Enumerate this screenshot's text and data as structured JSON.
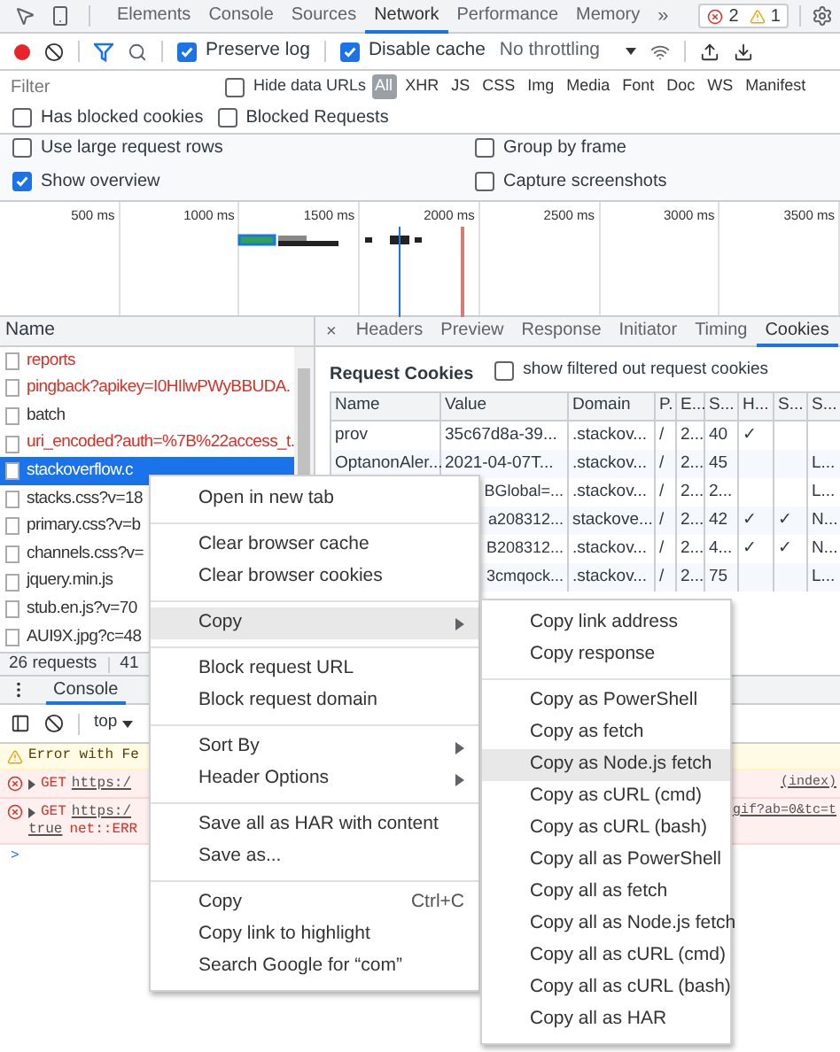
{
  "panel_tabs": [
    {
      "label": "Elements",
      "selected": false
    },
    {
      "label": "Console",
      "selected": false
    },
    {
      "label": "Sources",
      "selected": false
    },
    {
      "label": "Network",
      "selected": true
    },
    {
      "label": "Performance",
      "selected": false
    },
    {
      "label": "Memory",
      "selected": false
    }
  ],
  "more_tabs": "»",
  "issues": {
    "errors": "2",
    "warnings": "1"
  },
  "network_toolbar": {
    "recording": true,
    "preserve_log": {
      "label": "Preserve log",
      "checked": true
    },
    "disable_cache": {
      "label": "Disable cache",
      "checked": true
    },
    "throttling": "No throttling"
  },
  "filter": {
    "placeholder": "Filter",
    "hide_data_urls": {
      "label": "Hide data URLs",
      "checked": false
    },
    "types": [
      {
        "label": "All",
        "selected": true
      },
      {
        "label": "XHR",
        "selected": false
      },
      {
        "label": "JS",
        "selected": false
      },
      {
        "label": "CSS",
        "selected": false
      },
      {
        "label": "Img",
        "selected": false
      },
      {
        "label": "Media",
        "selected": false
      },
      {
        "label": "Font",
        "selected": false
      },
      {
        "label": "Doc",
        "selected": false
      },
      {
        "label": "WS",
        "selected": false
      },
      {
        "label": "Manifest",
        "selected": false
      }
    ]
  },
  "blocked_filters": [
    {
      "label": "Has blocked cookies",
      "checked": false
    },
    {
      "label": "Blocked Requests",
      "checked": false
    }
  ],
  "settings": [
    {
      "label": "Use large request rows",
      "checked": false
    },
    {
      "label": "Group by frame",
      "checked": false
    },
    {
      "label": "Show overview",
      "checked": true
    },
    {
      "label": "Capture screenshots",
      "checked": false
    }
  ],
  "timeline": {
    "ticks": [
      "500 ms",
      "1000 ms",
      "1500 ms",
      "2000 ms",
      "2500 ms",
      "3000 ms",
      "3500 ms"
    ]
  },
  "requests": {
    "header": "Name",
    "items": [
      {
        "name": "reports",
        "failed": true,
        "selected": false
      },
      {
        "name": "pingback?apikey=I0HIlwPWyBBUDA.",
        "failed": true,
        "selected": false
      },
      {
        "name": "batch",
        "failed": false,
        "selected": false
      },
      {
        "name": "uri_encoded?auth=%7B%22access_t.",
        "failed": true,
        "selected": false
      },
      {
        "name": "stackoverflow.c",
        "failed": false,
        "selected": true
      },
      {
        "name": "stacks.css?v=18",
        "failed": false,
        "selected": false
      },
      {
        "name": "primary.css?v=b",
        "failed": false,
        "selected": false
      },
      {
        "name": "channels.css?v=",
        "failed": false,
        "selected": false
      },
      {
        "name": "jquery.min.js",
        "failed": false,
        "selected": false
      },
      {
        "name": "stub.en.js?v=70",
        "failed": false,
        "selected": false
      },
      {
        "name": "AUI9X.jpg?c=48",
        "failed": false,
        "selected": false
      }
    ],
    "status": [
      "26 requests",
      "41"
    ]
  },
  "detail_tabs": [
    {
      "label": "Headers",
      "selected": false
    },
    {
      "label": "Preview",
      "selected": false
    },
    {
      "label": "Response",
      "selected": false
    },
    {
      "label": "Initiator",
      "selected": false
    },
    {
      "label": "Timing",
      "selected": false
    },
    {
      "label": "Cookies",
      "selected": true
    }
  ],
  "close": "×",
  "cookies": {
    "title": "Request Cookies",
    "show_filtered": {
      "label": "show filtered out request cookies",
      "checked": false
    },
    "columns": [
      "Name",
      "Value",
      "Domain",
      "P.",
      "E...",
      "S...",
      "H...",
      "S...",
      "S..."
    ],
    "rows": [
      {
        "kind": "full",
        "cells": [
          "prov",
          "35c67d8a-39...",
          ".stackov...",
          "/",
          "2...",
          "40",
          "✓",
          null,
          null
        ]
      },
      {
        "kind": "full",
        "cells": [
          "OptanonAler...",
          "2021-04-07T...",
          ".stackov...",
          "/",
          "2...",
          "45",
          null,
          null,
          "L..."
        ]
      },
      {
        "kind": "covered",
        "cells": [
          null,
          "BGlobal=...",
          ".stackov...",
          "/",
          "2...",
          "2...",
          null,
          null,
          "L..."
        ]
      },
      {
        "kind": "covered",
        "cells": [
          null,
          "a208312...",
          "stackove...",
          "/",
          "2...",
          "42",
          "✓",
          "✓",
          "N..."
        ]
      },
      {
        "kind": "covered",
        "cells": [
          null,
          "B208312...",
          ".stackov...",
          "/",
          "2...",
          "4...",
          "✓",
          "✓",
          "N..."
        ]
      },
      {
        "kind": "covered",
        "cells": [
          null,
          "3cmqock...",
          ".stackov...",
          "/",
          "2...",
          "75",
          null,
          null,
          "L..."
        ]
      }
    ]
  },
  "console": {
    "tab": "Console",
    "context": "top",
    "messages": [
      {
        "kind": "warning",
        "text": "Error with Fe"
      },
      {
        "kind": "error",
        "method": "GET",
        "url": "https:/",
        "source": "(index)"
      },
      {
        "kind": "error",
        "method": "GET",
        "url": "https:/",
        "source": "gif?ab=0&tc=t",
        "cont_link": "true",
        "cont_text": "net::ERR"
      }
    ],
    "prompt": ">"
  },
  "context_menu": {
    "groups": [
      [
        {
          "label": "Open in new tab",
          "highlighted": false
        }
      ],
      [
        {
          "label": "Clear browser cache",
          "highlighted": false
        },
        {
          "label": "Clear browser cookies",
          "highlighted": false
        }
      ],
      [
        {
          "label": "Copy",
          "highlighted": true,
          "submenu": true
        }
      ],
      [
        {
          "label": "Block request URL",
          "highlighted": false
        },
        {
          "label": "Block request domain",
          "highlighted": false
        }
      ],
      [
        {
          "label": "Sort By",
          "highlighted": false,
          "submenu": true
        },
        {
          "label": "Header Options",
          "highlighted": false,
          "submenu": true
        }
      ],
      [
        {
          "label": "Save all as HAR with content",
          "highlighted": false
        },
        {
          "label": "Save as...",
          "highlighted": false
        }
      ],
      [
        {
          "label": "Copy",
          "highlighted": false,
          "shortcut": "Ctrl+C"
        },
        {
          "label": "Copy link to highlight",
          "highlighted": false
        },
        {
          "label": "Search Google for “com”",
          "highlighted": false
        }
      ]
    ]
  },
  "copy_submenu": {
    "groups": [
      [
        {
          "label": "Copy link address",
          "highlighted": false
        },
        {
          "label": "Copy response",
          "highlighted": false
        }
      ],
      [
        {
          "label": "Copy as PowerShell",
          "highlighted": false
        },
        {
          "label": "Copy as fetch",
          "highlighted": false
        },
        {
          "label": "Copy as Node.js fetch",
          "highlighted": true
        },
        {
          "label": "Copy as cURL (cmd)",
          "highlighted": false
        },
        {
          "label": "Copy as cURL (bash)",
          "highlighted": false
        },
        {
          "label": "Copy all as PowerShell",
          "highlighted": false
        },
        {
          "label": "Copy all as fetch",
          "highlighted": false
        },
        {
          "label": "Copy all as Node.js fetch",
          "highlighted": false
        },
        {
          "label": "Copy all as cURL (cmd)",
          "highlighted": false
        },
        {
          "label": "Copy all as cURL (bash)",
          "highlighted": false
        },
        {
          "label": "Copy all as HAR",
          "highlighted": false
        }
      ]
    ]
  }
}
